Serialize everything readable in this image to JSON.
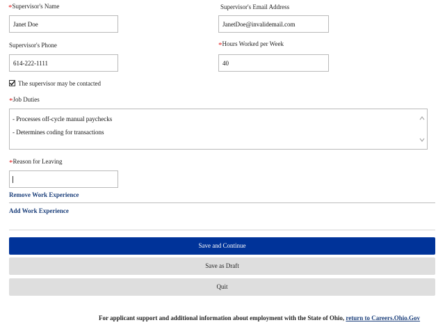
{
  "supervisor_name": {
    "label": "Supervisor's Name",
    "required": "*",
    "value": "Janet Doe"
  },
  "supervisor_email": {
    "label": "Supervisor's Email Address",
    "value": "JanetDoe@invalidemail.com"
  },
  "supervisor_phone": {
    "label": "Supervisor's Phone",
    "value": "614-222-1111"
  },
  "hours_per_week": {
    "label": "Hours Worked per Week",
    "required": "*",
    "value": "40"
  },
  "contact_checkbox": {
    "label": "The supervisor may be contacted",
    "checked": true
  },
  "job_duties": {
    "label": "Job Duties",
    "required": "*",
    "lines": [
      "- Processes off-cycle manual paychecks",
      "- Determines coding for transactions"
    ]
  },
  "reason_for_leaving": {
    "label": "Reason for Leaving",
    "required": "*",
    "value": ""
  },
  "links": {
    "remove_work_experience": "Remove Work Experience",
    "add_work_experience": "Add Work Experience"
  },
  "buttons": {
    "save_continue": "Save and Continue",
    "save_draft": "Save as Draft",
    "quit": "Quit"
  },
  "footer": {
    "text": "For applicant support and additional information about employment with the State of Ohio,",
    "link": "return to Careers.Ohio.Gov"
  },
  "colors": {
    "primary": "#003399",
    "secondary": "#dedede",
    "required": "#e01b1b",
    "link": "#1a3e7a"
  }
}
